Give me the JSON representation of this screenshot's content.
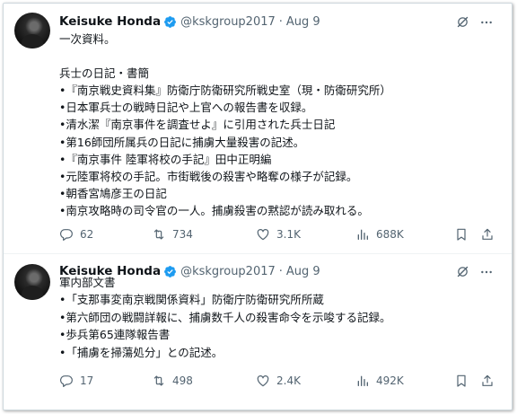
{
  "tweets": [
    {
      "author": {
        "name": "Keisuke Honda",
        "handle": "@kskgroup2017",
        "date": "Aug 9"
      },
      "lines": [
        "一次資料。",
        "",
        "兵士の日記・書簡",
        "•『南京戦史資料集』防衛庁防衛研究所戦史室（現・防衛研究所）",
        "•日本軍兵士の戦時日記や上官への報告書を収録。",
        "•清水潔『南京事件を調査せよ』に引用された兵士日記",
        "•第16師団所属兵の日記に捕虜大量殺害の記述。",
        "•『南京事件 陸軍将校の手記』田中正明編",
        "•元陸軍将校の手記。市街戦後の殺害や略奪の様子が記録。",
        "•朝香宮鳩彦王の日記",
        "•南京攻略時の司令官の一人。捕虜殺害の黙認が読み取れる。"
      ],
      "stats": {
        "replies": "62",
        "reposts": "734",
        "likes": "3.1K",
        "views": "688K"
      }
    },
    {
      "author": {
        "name": "Keisuke Honda",
        "handle": "@kskgroup2017",
        "date": "Aug 9"
      },
      "lines": [
        "軍内部文書",
        "•「支那事変南京戦関係資料」防衛庁防衛研究所所蔵",
        "•第六師団の戦闘詳報に、捕虜数千人の殺害命令を示唆する記録。",
        "•歩兵第65連隊報告書",
        "•「捕虜を掃蕩処分」との記述。"
      ],
      "stats": {
        "replies": "17",
        "reposts": "498",
        "likes": "2.4K",
        "views": "492K"
      }
    }
  ],
  "icons": {
    "verified": "verified-badge-icon",
    "grok": "grok-icon",
    "more": "more-icon",
    "reply": "reply-icon",
    "repost": "repost-icon",
    "like": "like-icon",
    "views": "views-icon",
    "bookmark": "bookmark-icon",
    "share": "share-icon"
  },
  "colors": {
    "text": "#0f1419",
    "muted": "#536471",
    "verified": "#1d9bf0",
    "border": "#cfd9de",
    "divider": "#eff3f4"
  }
}
